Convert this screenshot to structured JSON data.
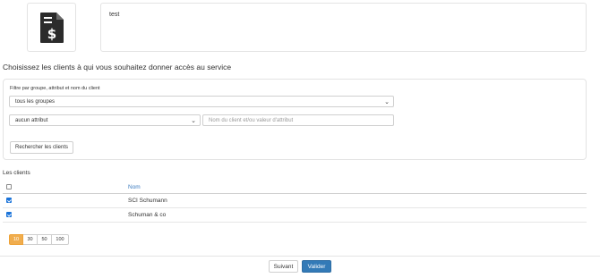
{
  "service": {
    "icon": "invoice-dollar-icon",
    "description": "test"
  },
  "section_title": "Choisissez les clients à qui vous souhaitez donner accès au service",
  "filter": {
    "label": "Filtre par groupe, attribut et nom du client",
    "group_select_value": "tous les groupes",
    "attribute_select_value": "aucun attribut",
    "search_placeholder": "Nom du client et/ou valeur d'attribut",
    "search_button": "Rechercher les clients"
  },
  "clients": {
    "title": "Les clients",
    "column_name": "Nom",
    "rows": [
      {
        "name": "SCI Schumann",
        "checked": true
      },
      {
        "name": "Schuman & co",
        "checked": true
      }
    ]
  },
  "pagination": {
    "options": [
      "10",
      "30",
      "50",
      "100"
    ],
    "active": "10"
  },
  "actions": {
    "next": "Suivant",
    "validate": "Valider"
  },
  "colors": {
    "primary": "#337ab7",
    "active_page": "#f0ad4e",
    "link": "#3b7bbf"
  }
}
